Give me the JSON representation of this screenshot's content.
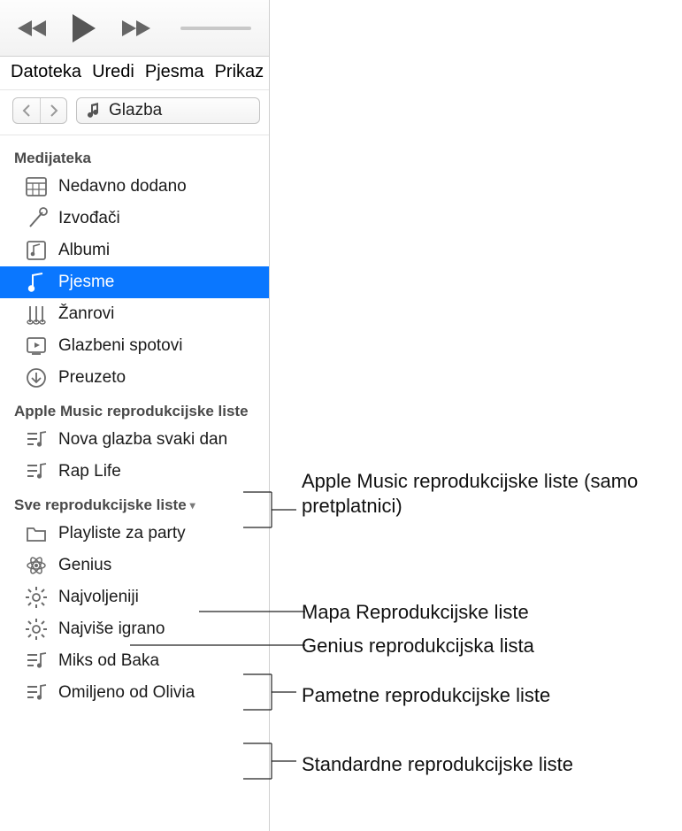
{
  "menu": {
    "items": [
      "Datoteka",
      "Uredi",
      "Pjesma",
      "Prikaz"
    ]
  },
  "media_selector": {
    "label": "Glazba"
  },
  "sections": {
    "library": {
      "header": "Medijateka",
      "items": [
        {
          "label": "Nedavno dodano",
          "icon": "grid"
        },
        {
          "label": "Izvođači",
          "icon": "mic"
        },
        {
          "label": "Albumi",
          "icon": "album"
        },
        {
          "label": "Pjesme",
          "icon": "note",
          "selected": true
        },
        {
          "label": "Žanrovi",
          "icon": "guitar"
        },
        {
          "label": "Glazbeni spotovi",
          "icon": "video"
        },
        {
          "label": "Preuzeto",
          "icon": "download"
        }
      ]
    },
    "apple_music": {
      "header": "Apple Music reprodukcijske liste",
      "items": [
        {
          "label": "Nova glazba svaki dan",
          "icon": "playlist"
        },
        {
          "label": "Rap Life",
          "icon": "playlist"
        }
      ]
    },
    "all_playlists": {
      "header": "Sve reprodukcijske liste",
      "items": [
        {
          "label": "Playliste za party",
          "icon": "folder"
        },
        {
          "label": "Genius",
          "icon": "atom"
        },
        {
          "label": "Najvoljeniji",
          "icon": "gear"
        },
        {
          "label": "Najviše igrano",
          "icon": "gear"
        },
        {
          "label": "Miks od Baka",
          "icon": "playlist"
        },
        {
          "label": "Omiljeno od Olivia",
          "icon": "playlist"
        }
      ]
    }
  },
  "callouts": {
    "apple_music": "Apple Music reprodukcijske liste (samo pretplatnici)",
    "folder": "Mapa Reprodukcijske liste",
    "genius": "Genius reprodukcijska lista",
    "smart": "Pametne reprodukcijske liste",
    "standard": "Standardne reprodukcijske liste"
  }
}
